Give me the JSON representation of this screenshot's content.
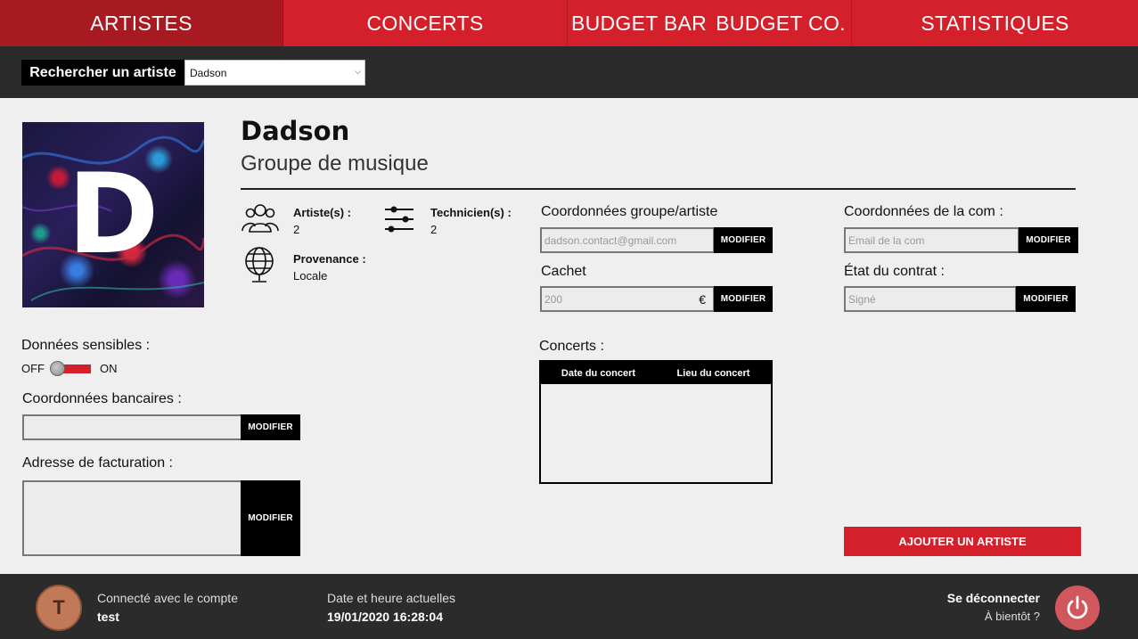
{
  "nav": {
    "tabs": [
      {
        "label": "ARTISTES"
      },
      {
        "label": "CONCERTS"
      },
      {
        "label": "BUDGET BAR"
      },
      {
        "label": "BUDGET CO."
      },
      {
        "label": "STATISTIQUES"
      }
    ],
    "active_tab": "ARTISTES"
  },
  "search": {
    "label": "Rechercher un artiste",
    "selected": "Dadson"
  },
  "artist": {
    "initial": "D",
    "name": "Dadson",
    "type": "Groupe de musique",
    "artists_label": "Artiste(s) :",
    "artists_count": "2",
    "technicians_label": "Technicien(s) :",
    "technicians_count": "2",
    "origin_label": "Provenance :",
    "origin_value": "Locale"
  },
  "contact_group": {
    "title": "Coordonnées groupe/artiste",
    "value": "dadson.contact@gmail.com",
    "button": "MODIFIER"
  },
  "fee": {
    "title": "Cachet",
    "value": "200",
    "currency": "€",
    "button": "MODIFIER"
  },
  "contact_com": {
    "title": "Coordonnées de la com :",
    "placeholder": "Email de la com",
    "button": "MODIFIER"
  },
  "contract": {
    "title": "État du contrat :",
    "value": "Signé",
    "button": "MODIFIER"
  },
  "sensitive": {
    "title": "Données sensibles :",
    "off_label": "OFF",
    "on_label": "ON",
    "state": "ON"
  },
  "bank": {
    "title": "Coordonnées bancaires :",
    "value": "",
    "button": "MODIFIER"
  },
  "billing": {
    "title": "Adresse de facturation :",
    "value": "",
    "button": "MODIFIER"
  },
  "concerts": {
    "title": "Concerts :",
    "columns": [
      "Date du concert",
      "Lieu du concert"
    ],
    "rows": []
  },
  "add_artist": "AJOUTER UN ARTISTE",
  "footer": {
    "avatar_initial": "T",
    "connected_label": "Connecté avec le compte",
    "account": "test",
    "datetime_label": "Date et heure actuelles",
    "datetime": "19/01/2020 16:28:04",
    "logout_label": "Se déconnecter",
    "logout_sub": "À bientôt ?"
  },
  "colors": {
    "accent": "#d4202b",
    "accent_dark": "#a81a22",
    "dark_bar": "#2b2b2b",
    "background": "#efefef"
  }
}
